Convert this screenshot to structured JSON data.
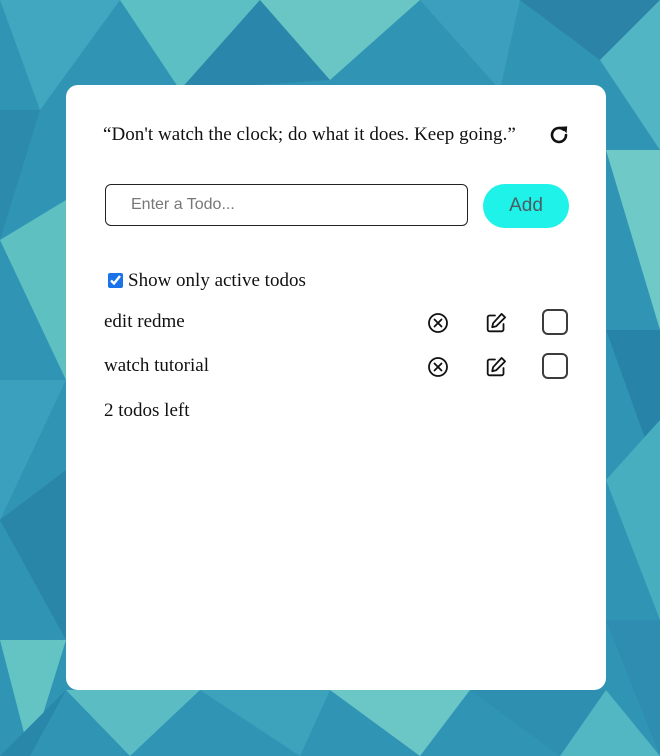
{
  "colors": {
    "accent_button": "#1ff2e8",
    "card_background": "#ffffff",
    "background_primary": "#2f8fb1",
    "background_secondary": "#5fbfc3"
  },
  "quote": {
    "text": "“Don't watch the clock; do what it does. Keep going.”",
    "refresh_icon": "refresh-icon"
  },
  "form": {
    "input_placeholder": "Enter a Todo...",
    "input_value": "",
    "add_label": "Add"
  },
  "filter": {
    "label": "Show only active todos",
    "checked": true
  },
  "todos": [
    {
      "text": "edit redme",
      "remove_icon": "circle-x-icon",
      "edit_icon": "edit-icon",
      "done": false
    },
    {
      "text": "watch tutorial",
      "remove_icon": "circle-x-icon",
      "edit_icon": "edit-icon",
      "done": false
    }
  ],
  "footer": {
    "count_text": "2 todos left"
  }
}
